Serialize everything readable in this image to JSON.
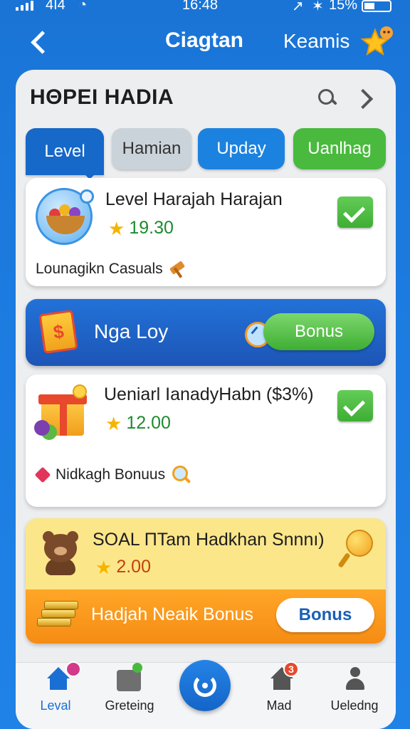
{
  "status_bar": {
    "carrier": "4I4",
    "time": "16:48",
    "battery": "15%"
  },
  "header": {
    "title": "Ciagtan",
    "user": "Keamis"
  },
  "panel": {
    "title": "HΘPEI HADIA"
  },
  "tabs": [
    {
      "label": "Level"
    },
    {
      "label": "Hamian"
    },
    {
      "label": "Upday"
    },
    {
      "label": "Uanlhag"
    }
  ],
  "cards": [
    {
      "title": "Level Harajah Harajan",
      "value": "19.30",
      "subtitle": "Lounagikn Casuals"
    },
    {
      "title": "Ueniarl IanadyHabn ($3%)",
      "value": "12.00",
      "subtitle": "Nidkagh Bonuus"
    }
  ],
  "banner": {
    "label": "Nga Loy",
    "button": "Bonus"
  },
  "promo": {
    "title": "SOAL ΠTam Hadkhan Snnnı)",
    "value": "2.00",
    "label": "Hadjah Neaik Bonus",
    "button": "Bonus"
  },
  "bottom_nav": [
    {
      "label": "Leval"
    },
    {
      "label": "Greteing"
    },
    {
      "label": "Mad",
      "badge": "3"
    },
    {
      "label": "Ueledng"
    }
  ],
  "colors": {
    "primary_blue": "#1a6fd4",
    "green": "#49ba3d",
    "orange": "#f58c14",
    "yellow": "#fbe68a"
  }
}
